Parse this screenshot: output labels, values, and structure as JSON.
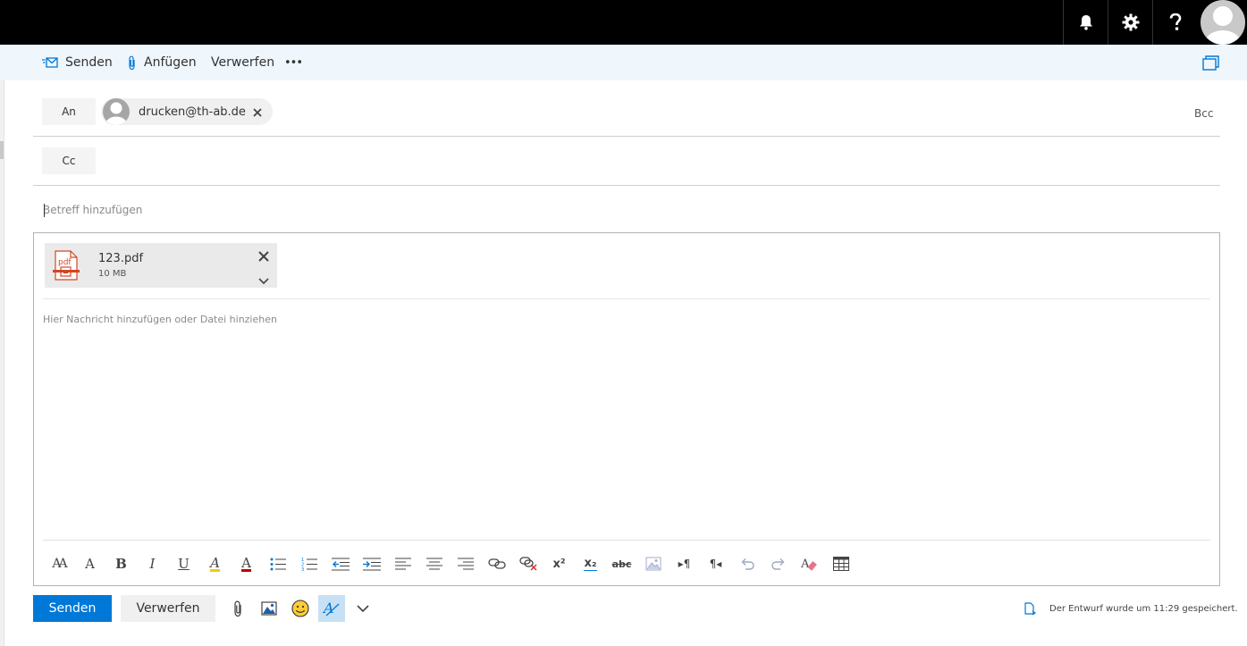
{
  "commandbar": {
    "send_label": "Senden",
    "attach_label": "Anfügen",
    "discard_label": "Verwerfen",
    "more_label": "•••"
  },
  "recipients": {
    "to_label": "An",
    "cc_label": "Cc",
    "bcc_label": "Bcc",
    "to_chip": {
      "address": "drucken@th-ab.de"
    }
  },
  "subject": {
    "placeholder": "Betreff hinzufügen"
  },
  "attachment": {
    "name": "123.pdf",
    "size": "10 MB",
    "file_type": "pdf"
  },
  "body": {
    "placeholder": "Hier Nachricht hinzufügen oder Datei hinziehen"
  },
  "formatting": {
    "font_size_label": "AA",
    "grow_label": "A",
    "bold_label": "B",
    "italic_label": "I",
    "underline_label": "U",
    "highlight_label": "A",
    "font_color_label": "A",
    "superscript_label": "x²",
    "subscript_label": "x₂",
    "strikethrough_label": "abc",
    "ltr_label": "▸¶",
    "rtl_label": "¶◂"
  },
  "footer": {
    "send_label": "Senden",
    "discard_label": "Verwerfen",
    "status": "Der Entwurf wurde um 11:29 gespeichert."
  },
  "colors": {
    "accent": "#0078d7",
    "topbar": "#000000",
    "commandbar": "#eff6fc",
    "pdf_red": "#d24726"
  }
}
